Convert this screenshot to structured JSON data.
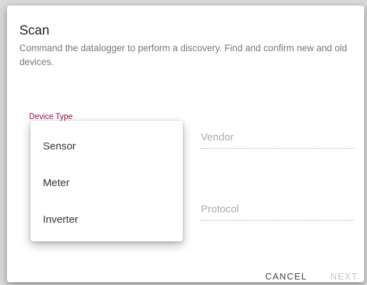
{
  "dialog": {
    "title": "Scan",
    "description": "Command the datalogger to perform a discovery. Find and confirm new and old devices."
  },
  "form": {
    "device_type": {
      "label": "Device Type"
    },
    "vendor": {
      "placeholder": "Vendor"
    },
    "protocol": {
      "placeholder": "Protocol"
    }
  },
  "device_type_menu": {
    "options": [
      "Sensor",
      "Meter",
      "Inverter"
    ]
  },
  "actions": {
    "cancel_label": "CANCEL",
    "next_label": "NEXT"
  },
  "colors": {
    "accent": "#8e1456",
    "disabled": "#c2c2c2"
  }
}
